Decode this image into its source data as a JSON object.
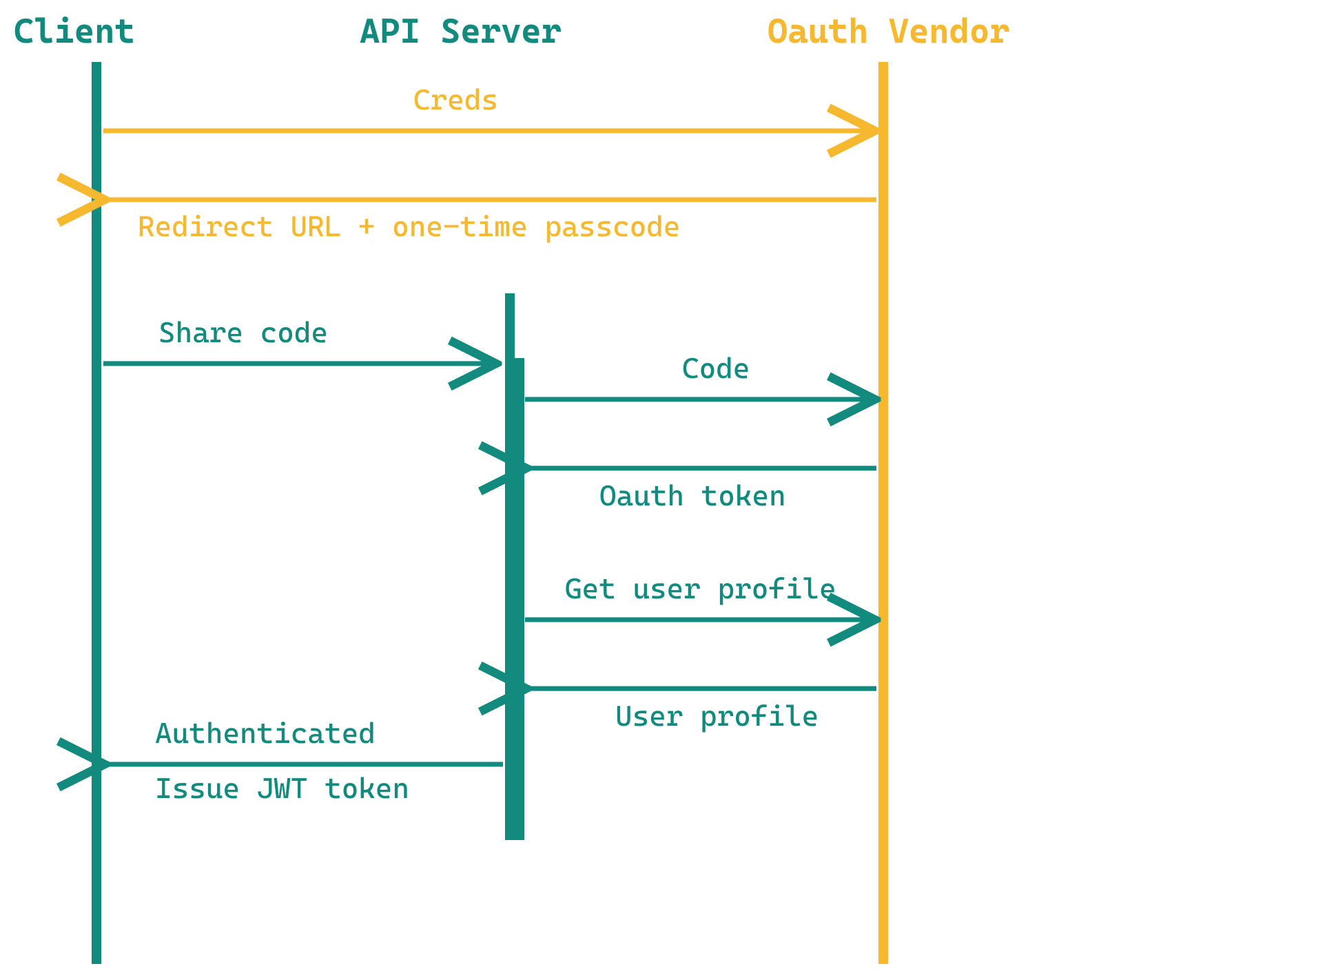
{
  "colors": {
    "teal": "#128b7e",
    "amber": "#f5b82e"
  },
  "participants": {
    "client": "Client",
    "api_server": "API Server",
    "oauth_vendor": "Oauth Vendor"
  },
  "messages": {
    "m1": {
      "label": "Creds",
      "from": "client",
      "to": "oauth_vendor",
      "color": "amber"
    },
    "m2": {
      "label": "Redirect URL + one-time passcode",
      "from": "oauth_vendor",
      "to": "client",
      "color": "amber"
    },
    "m3": {
      "label": "Share code",
      "from": "client",
      "to": "api_server",
      "color": "teal"
    },
    "m4": {
      "label": "Code",
      "from": "api_server",
      "to": "oauth_vendor",
      "color": "teal"
    },
    "m5": {
      "label": "Oauth token",
      "from": "oauth_vendor",
      "to": "api_server",
      "color": "teal"
    },
    "m6": {
      "label": "Get user profile",
      "from": "api_server",
      "to": "oauth_vendor",
      "color": "teal"
    },
    "m7": {
      "label": "User profile",
      "from": "oauth_vendor",
      "to": "api_server",
      "color": "teal"
    },
    "m8_line1": "Authenticated",
    "m8_line2": "Issue JWT token",
    "m8": {
      "from": "api_server",
      "to": "client",
      "color": "teal"
    }
  },
  "chart_data": {
    "type": "sequence-diagram",
    "participants": [
      "Client",
      "API Server",
      "Oauth Vendor"
    ],
    "interactions": [
      {
        "from": "Client",
        "to": "Oauth Vendor",
        "label": "Creds"
      },
      {
        "from": "Oauth Vendor",
        "to": "Client",
        "label": "Redirect URL + one-time passcode"
      },
      {
        "from": "Client",
        "to": "API Server",
        "label": "Share code"
      },
      {
        "from": "API Server",
        "to": "Oauth Vendor",
        "label": "Code"
      },
      {
        "from": "Oauth Vendor",
        "to": "API Server",
        "label": "Oauth token"
      },
      {
        "from": "API Server",
        "to": "Oauth Vendor",
        "label": "Get user profile"
      },
      {
        "from": "Oauth Vendor",
        "to": "API Server",
        "label": "User profile"
      },
      {
        "from": "API Server",
        "to": "Client",
        "label": "Authenticated / Issue JWT token"
      }
    ]
  }
}
